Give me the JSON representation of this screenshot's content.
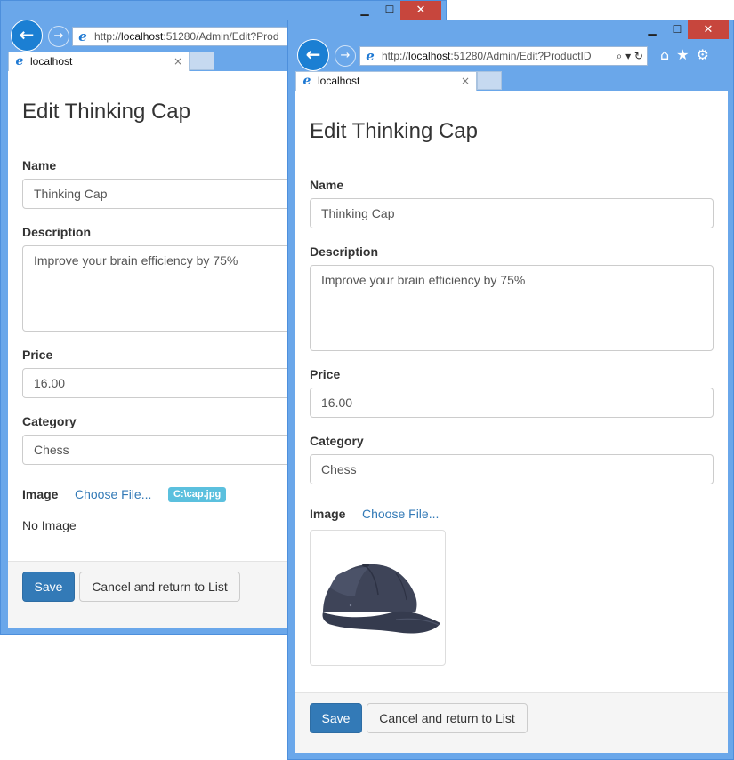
{
  "browser": {
    "url_prefix": "http://",
    "url_host": "localhost",
    "url_back_window": ":51280/Admin/Edit?Prod",
    "url_front_window": ":51280/Admin/Edit?ProductID",
    "tab_title": "localhost",
    "tab_close": "×",
    "window_minimize": "▁",
    "window_maximize": "☐",
    "window_close": "✕",
    "address_icons": "⌕ ▾ ↻",
    "toolbar_icons": "⌂ ★ ⚙"
  },
  "icons": {
    "back": "back-arrow-icon",
    "forward": "forward-arrow-icon",
    "ie": "ie-logo-icon",
    "home": "home-icon",
    "favorites": "star-icon",
    "settings": "gear-icon"
  },
  "form": {
    "title": "Edit Thinking Cap",
    "name_label": "Name",
    "name_value": "Thinking Cap",
    "description_label": "Description",
    "description_value": "Improve your brain efficiency by 75%",
    "price_label": "Price",
    "price_value": "16.00",
    "category_label": "Category",
    "category_value": "Chess",
    "image_label": "Image",
    "choose_file": "Choose File...",
    "selected_file": "C:\\cap.jpg",
    "no_image": "No Image",
    "save_button": "Save",
    "cancel_button": "Cancel and return to List"
  },
  "colors": {
    "window_frame": "#6aa7ea",
    "primary_button": "#337ab7",
    "link": "#337ab7",
    "badge": "#5bc0de",
    "close_button": "#c7463d"
  }
}
